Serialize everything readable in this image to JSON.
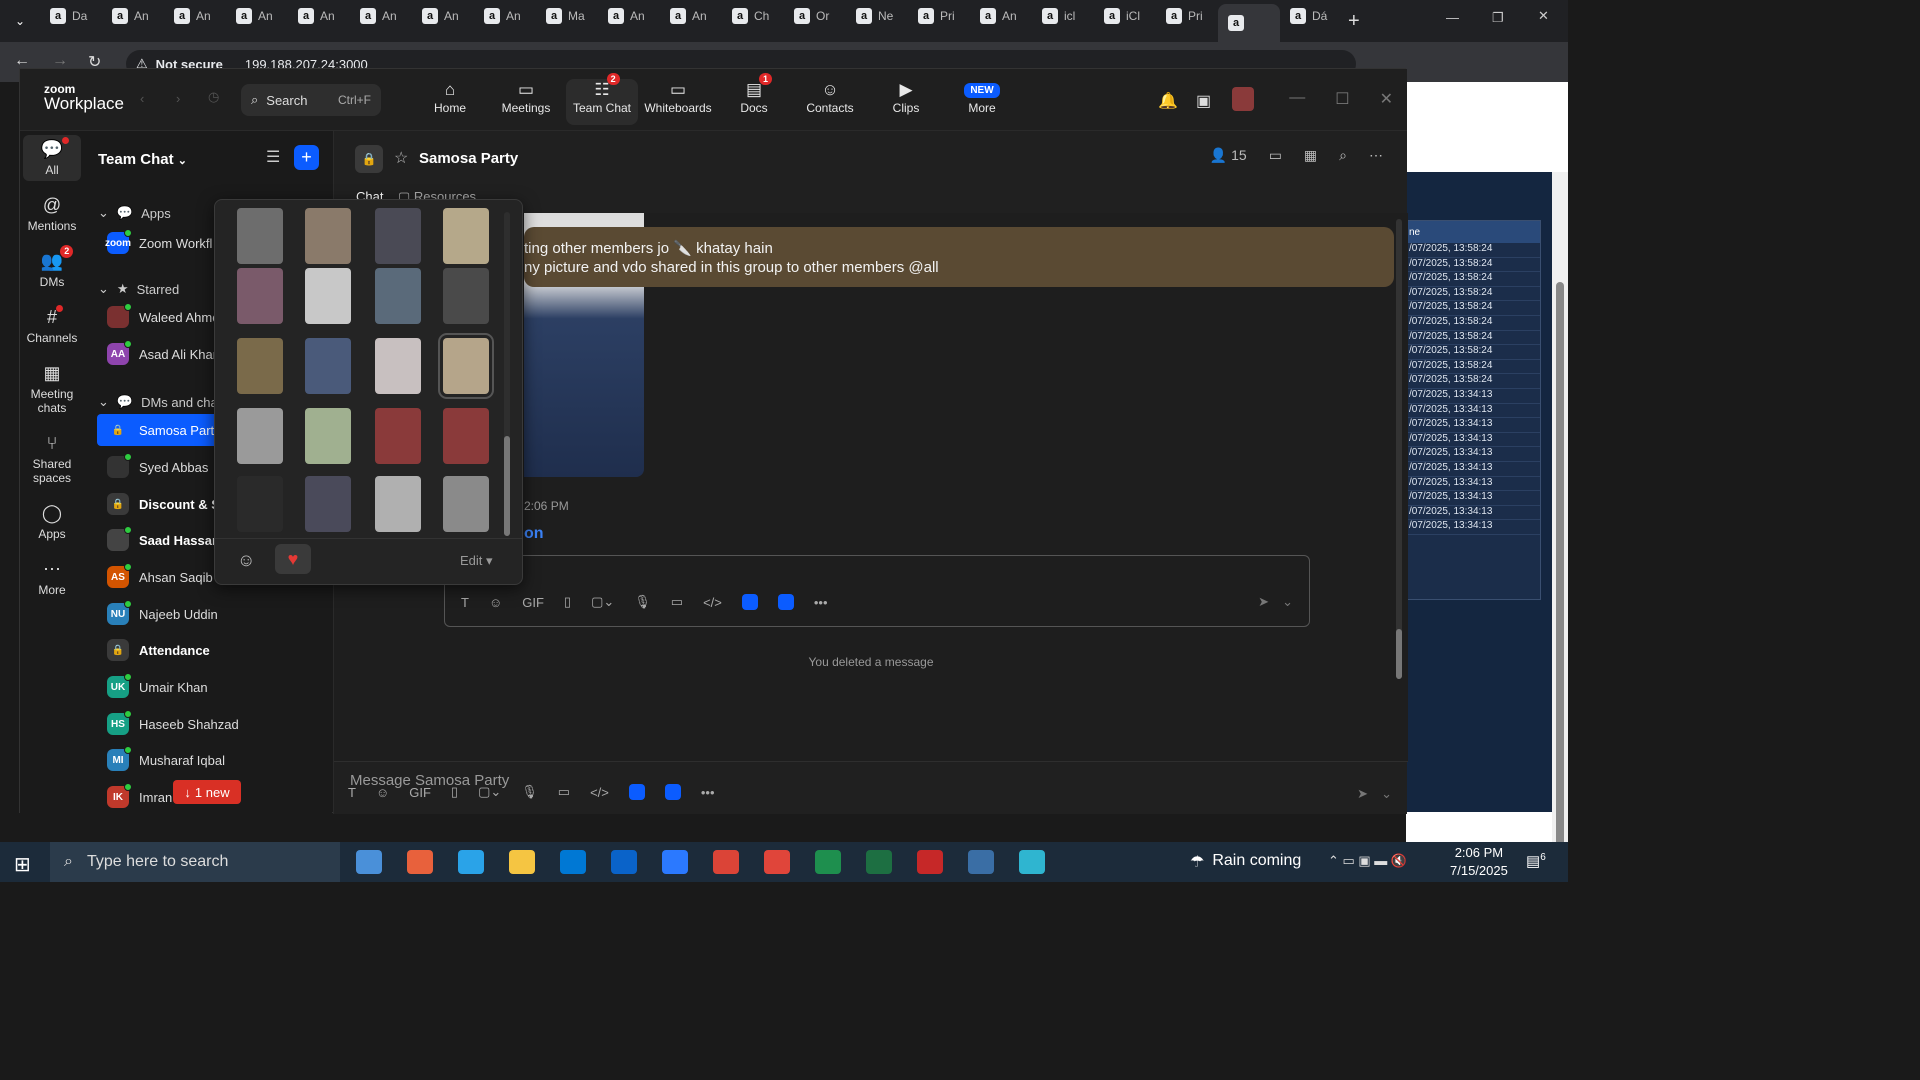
{
  "browser": {
    "tabs": [
      "Da",
      "An",
      "An",
      "An",
      "An",
      "An",
      "An",
      "An",
      "Ma",
      "An",
      "An",
      "Ch",
      "Or",
      "Ne",
      "Pri",
      "An",
      "icl",
      "iCl",
      "Pri",
      "",
      "Dá"
    ],
    "url_security": "Not secure",
    "url": "199.188.207.24:3000"
  },
  "zoom": {
    "logo_top": "zoom",
    "logo_bottom": "Workplace",
    "search_label": "Search",
    "search_shortcut": "Ctrl+F",
    "nav": [
      {
        "label": "Home",
        "icon": "home-icon",
        "badge": ""
      },
      {
        "label": "Meetings",
        "icon": "video-icon",
        "badge": ""
      },
      {
        "label": "Team Chat",
        "icon": "chat-icon",
        "badge": "2"
      },
      {
        "label": "Whiteboards",
        "icon": "whiteboard-icon",
        "badge": ""
      },
      {
        "label": "Docs",
        "icon": "docs-icon",
        "badge": "1"
      },
      {
        "label": "Contacts",
        "icon": "contacts-icon",
        "badge": ""
      },
      {
        "label": "Clips",
        "icon": "clips-icon",
        "badge": ""
      },
      {
        "label": "More",
        "icon": "more-icon",
        "badge": "NEW"
      }
    ]
  },
  "rail": [
    {
      "label": "All",
      "icon": "chat-bubble-icon",
      "badge": "dot"
    },
    {
      "label": "Mentions",
      "icon": "at-icon",
      "badge": ""
    },
    {
      "label": "DMs",
      "icon": "people-icon",
      "badge": "2"
    },
    {
      "label": "Channels",
      "icon": "hash-icon",
      "badge": "dot"
    },
    {
      "label": "Meeting chats",
      "icon": "calendar-icon",
      "badge": ""
    },
    {
      "label": "Shared spaces",
      "icon": "share-icon",
      "badge": ""
    },
    {
      "label": "Apps",
      "icon": "apps-icon",
      "badge": ""
    },
    {
      "label": "More",
      "icon": "dots-icon",
      "badge": ""
    }
  ],
  "sidebar": {
    "title": "Team Chat",
    "sections": {
      "apps": "Apps",
      "starred": "Starred",
      "dms": "DMs and chann"
    },
    "items": [
      {
        "name": "Zoom Workfl",
        "initials": "zoom",
        "color": "#0b5cff",
        "bold": false
      },
      {
        "name": "Waleed Ahme",
        "initials": "",
        "color": "#7a3030",
        "bold": false
      },
      {
        "name": "Asad Ali Khan",
        "initials": "AA",
        "color": "#8e44ad",
        "bold": false
      },
      {
        "name": "Samosa Party",
        "initials": "🔒",
        "color": "#0b5cff",
        "bold": false
      },
      {
        "name": "Syed Abbas",
        "initials": "",
        "color": "#333",
        "bold": false
      },
      {
        "name": "Discount & S",
        "initials": "🔒",
        "color": "#3a3a3a",
        "bold": true
      },
      {
        "name": "Saad Hassan",
        "initials": "",
        "color": "#444",
        "bold": true
      },
      {
        "name": "Ahsan Saqib",
        "initials": "AS",
        "color": "#d35400",
        "bold": false
      },
      {
        "name": "Najeeb Uddin",
        "initials": "NU",
        "color": "#2980b9",
        "bold": false
      },
      {
        "name": "Attendance",
        "initials": "🔒",
        "color": "#3a3a3a",
        "bold": true
      },
      {
        "name": "Umair Khan",
        "initials": "UK",
        "color": "#16a085",
        "bold": false
      },
      {
        "name": "Haseeb Shahzad",
        "initials": "HS",
        "color": "#16a085",
        "bold": false
      },
      {
        "name": "Musharaf Iqbal",
        "initials": "MI",
        "color": "#2980b9",
        "bold": false
      },
      {
        "name": "Imran",
        "initials": "IK",
        "color": "#c0392b",
        "bold": false
      }
    ],
    "new_pill": "1 new"
  },
  "channel": {
    "name": "Samosa Party",
    "member_count": "15",
    "tab_chat": "Chat",
    "tab_resources": "Resources",
    "message_line1": "ting other members jo 🔪 khatay hain",
    "message_line2": "ny picture and vdo shared in this group to other members @all",
    "message_time": "2:06 PM",
    "message_link": "on",
    "deleted_note": "You deleted a message",
    "compose_placeholder": "Message Samosa Party"
  },
  "popup": {
    "edit_label": "Edit",
    "thumb_colors": [
      [
        "#6d6d6d",
        "#8a7a6a",
        "#4a4a55",
        "#b5a88a"
      ],
      [
        "#7a5a6a",
        "#c8c8c8",
        "#5a6a7a",
        "#4a4a4a"
      ],
      [
        "#7a6a4a",
        "#4a5a7a",
        "#c8c0c0",
        "#b5a58a"
      ],
      [
        "#9a9a9a",
        "#a0b090",
        "#8a3a3a",
        "#8a3a3a"
      ],
      [
        "#2a2a2a",
        "#4a4a5a",
        "#b0b0b0",
        "#8a8a8a"
      ]
    ]
  },
  "right_page": {
    "header": "ne",
    "rows": [
      "/07/2025, 13:58:24",
      "/07/2025, 13:58:24",
      "/07/2025, 13:58:24",
      "/07/2025, 13:58:24",
      "/07/2025, 13:58:24",
      "/07/2025, 13:58:24",
      "/07/2025, 13:58:24",
      "/07/2025, 13:58:24",
      "/07/2025, 13:58:24",
      "/07/2025, 13:58:24",
      "/07/2025, 13:34:13",
      "/07/2025, 13:34:13",
      "/07/2025, 13:34:13",
      "/07/2025, 13:34:13",
      "/07/2025, 13:34:13",
      "/07/2025, 13:34:13",
      "/07/2025, 13:34:13",
      "/07/2025, 13:34:13",
      "/07/2025, 13:34:13",
      "/07/2025, 13:34:13"
    ]
  },
  "taskbar": {
    "search_placeholder": "Type here to search",
    "weather": "Rain coming",
    "time": "2:06 PM",
    "date": "7/15/2025",
    "notifications": "6",
    "app_colors": [
      "#4a90d9",
      "#e8613c",
      "#2aa3e8",
      "#f5c542",
      "#0078d4",
      "#0a63c9",
      "#2b79ff",
      "#db4437",
      "#e0453a",
      "#1e8f4e",
      "#1d6f42",
      "#c62828",
      "#3a6ea5",
      "#2fb5d0"
    ]
  }
}
